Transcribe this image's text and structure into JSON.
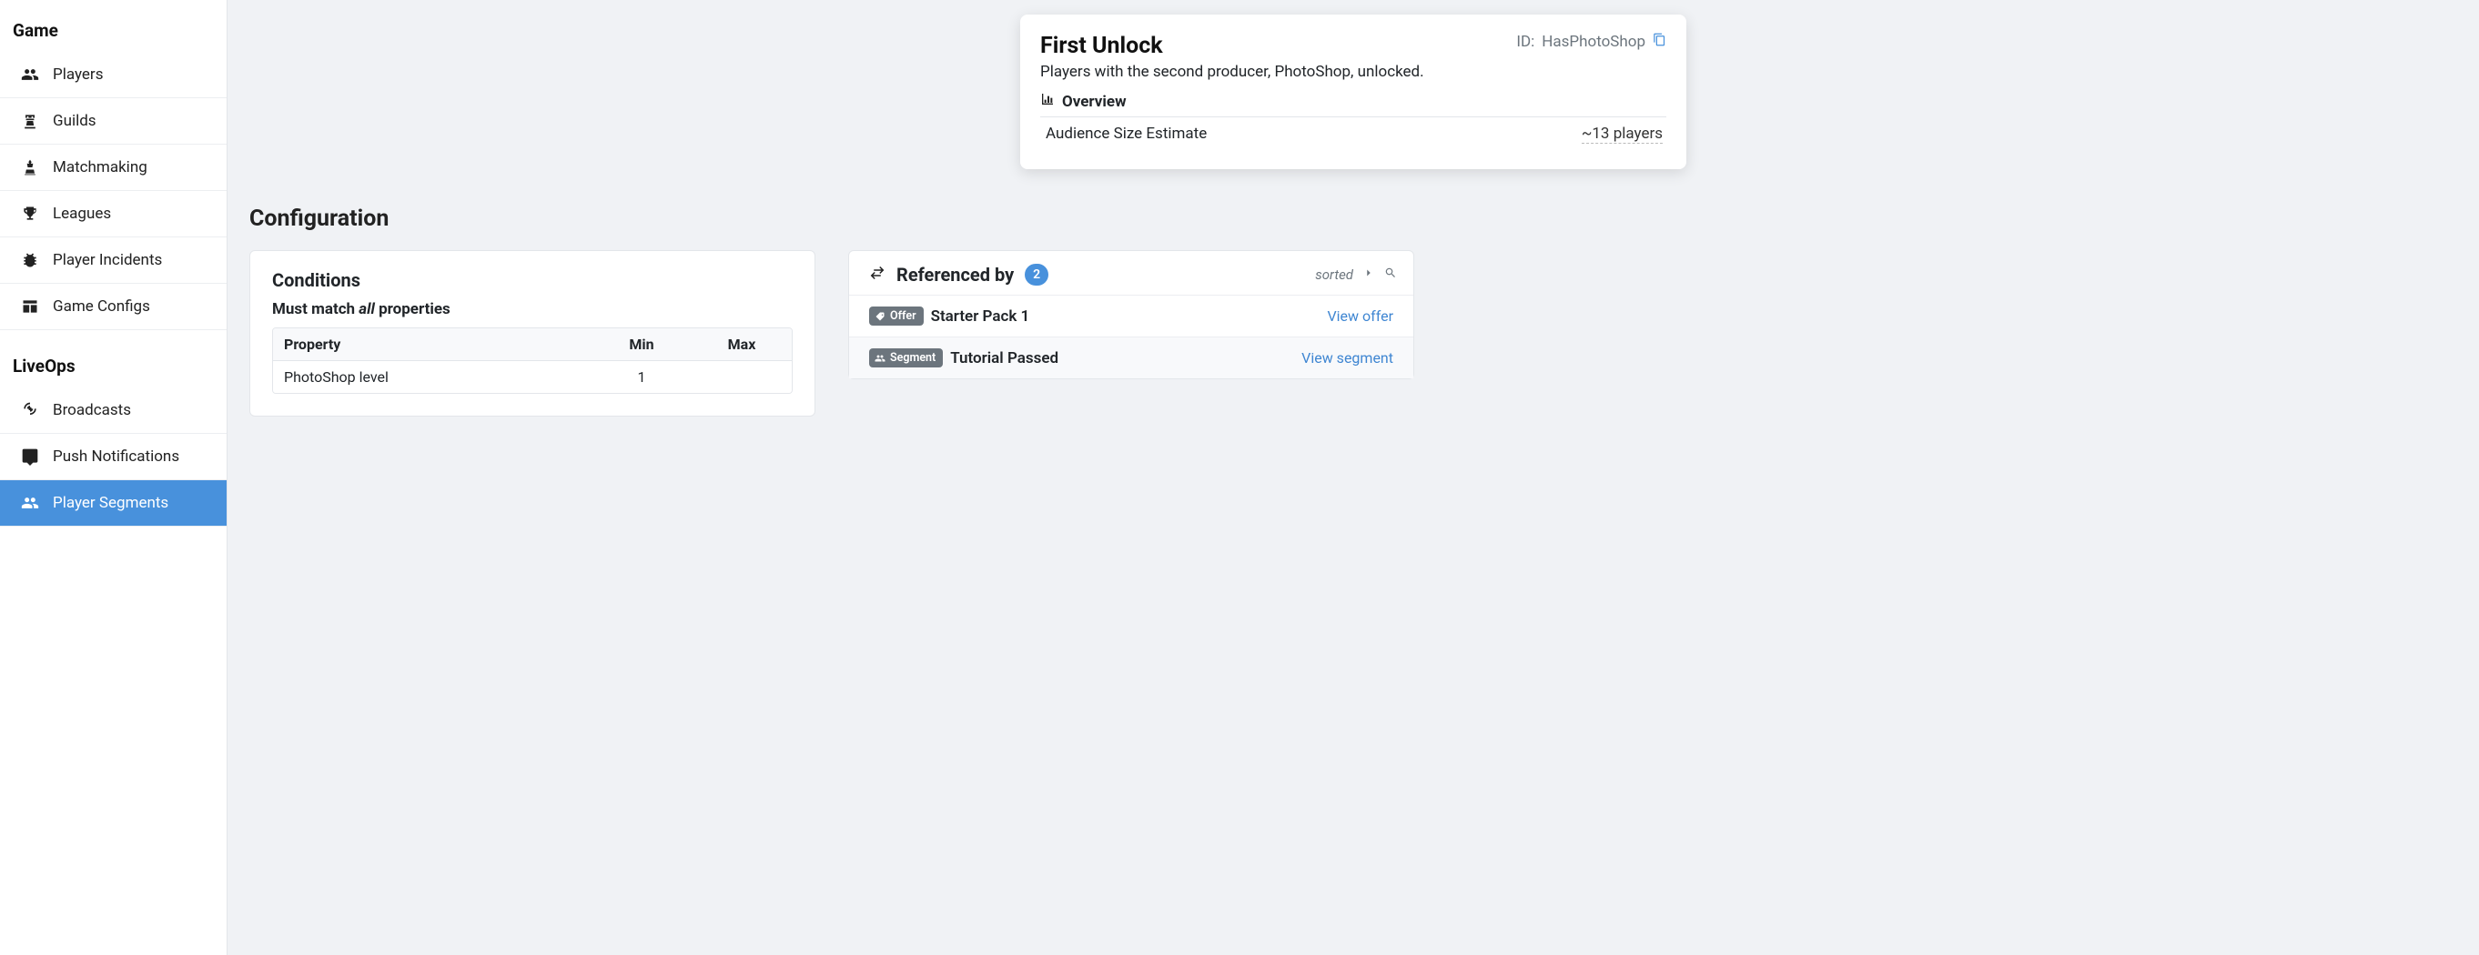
{
  "sidebar": {
    "groups": [
      {
        "title": "Game",
        "items": [
          {
            "label": "Players",
            "icon": "users"
          },
          {
            "label": "Guilds",
            "icon": "rook"
          },
          {
            "label": "Matchmaking",
            "icon": "chess"
          },
          {
            "label": "Leagues",
            "icon": "trophy"
          },
          {
            "label": "Player Incidents",
            "icon": "bug"
          },
          {
            "label": "Game Configs",
            "icon": "table"
          }
        ]
      },
      {
        "title": "LiveOps",
        "items": [
          {
            "label": "Broadcasts",
            "icon": "broadcast"
          },
          {
            "label": "Push Notifications",
            "icon": "comment"
          },
          {
            "label": "Player Segments",
            "icon": "users",
            "active": true
          }
        ]
      }
    ]
  },
  "header": {
    "title": "First Unlock",
    "id_prefix": "ID: ",
    "id_value": "HasPhotoShop",
    "description": "Players with the second producer, PhotoShop, unlocked.",
    "overview_label": "Overview",
    "audience_label": "Audience Size Estimate",
    "audience_value": "~13 players"
  },
  "config_heading": "Configuration",
  "conditions": {
    "title": "Conditions",
    "match_pre": "Must match ",
    "match_em": "all",
    "match_post": " properties",
    "columns": {
      "property": "Property",
      "min": "Min",
      "max": "Max"
    },
    "rows": [
      {
        "property": "PhotoShop level",
        "min": "1",
        "max": ""
      }
    ]
  },
  "referenced": {
    "title": "Referenced by",
    "count": "2",
    "sorted_label": "sorted",
    "rows": [
      {
        "tag": "Offer",
        "tag_icon": "tag",
        "name": "Starter Pack 1",
        "link": "View offer"
      },
      {
        "tag": "Segment",
        "tag_icon": "users",
        "name": "Tutorial Passed",
        "link": "View segment"
      }
    ]
  }
}
